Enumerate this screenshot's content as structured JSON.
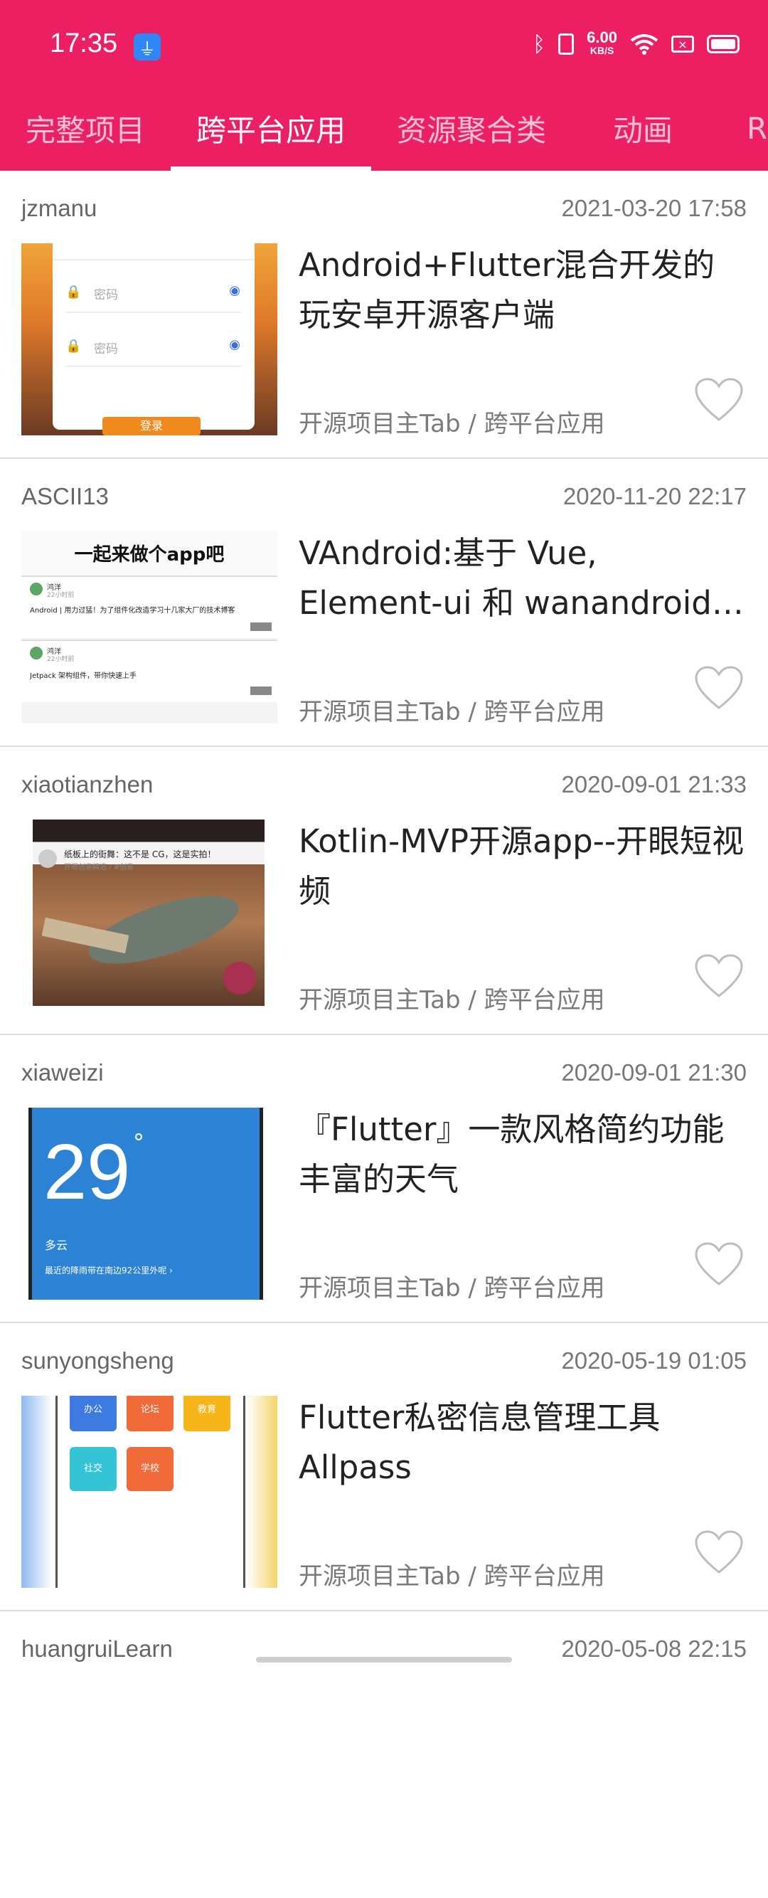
{
  "status_bar": {
    "time": "17:35",
    "net_speed_value": "6.00",
    "net_speed_unit": "KB/S",
    "icons": [
      "usb-debug-icon",
      "bluetooth-icon",
      "vibrate-icon",
      "wifi-icon",
      "sim-card-icon",
      "battery-icon"
    ]
  },
  "tabs": [
    {
      "label": "完整项目",
      "active": false
    },
    {
      "label": "跨平台应用",
      "active": true
    },
    {
      "label": "资源聚合类",
      "active": false
    },
    {
      "label": "动画",
      "active": false
    },
    {
      "label": "R",
      "active": false
    }
  ],
  "items": [
    {
      "author": "jzmanu",
      "date": "2021-03-20 17:58",
      "title": "Android+Flutter混合开发的玩安卓开源客户端",
      "chapter": "开源项目主Tab / 跨平台应用",
      "thumb_text": [
        "密码",
        "密码",
        "登录"
      ]
    },
    {
      "author": "ASCII13",
      "date": "2020-11-20 22:17",
      "title": "VAndroid:基于 Vue, Element-ui 和 wanandroid API 的开源客户端",
      "chapter": "开源项目主Tab / 跨平台应用",
      "thumb_text": [
        "一起来做个app吧",
        "鸿洋",
        "22小时前",
        "Android | 用力过猛！为了组件化改造学习十几家大厂的技术博客",
        "鸿洋",
        "22小时前",
        "Jetpack 架构组件，带你快速上手"
      ]
    },
    {
      "author": "xiaotianzhen",
      "date": "2020-09-01 21:33",
      "title": "Kotlin-MVP开源app--开眼短视频",
      "chapter": "开源项目主Tab / 跨平台应用",
      "thumb_text": [
        "纸板上的街舞：这不是 CG，这是实拍！",
        "开眼创意精选 / #创意"
      ]
    },
    {
      "author": "xiaweizi",
      "date": "2020-09-01 21:30",
      "title": "『Flutter』一款风格简约功能丰富的天气",
      "chapter": "开源项目主Tab / 跨平台应用",
      "thumb_text": [
        "29",
        "°",
        "多云",
        "最近的降雨带在南边92公里外呢 ›"
      ]
    },
    {
      "author": "sunyongsheng",
      "date": "2020-05-19 01:05",
      "title": "Flutter私密信息管理工具Allpass",
      "chapter": "开源项目主Tab / 跨平台应用",
      "thumb_text": [
        "办公",
        "论坛",
        "教育",
        "社交",
        "学校"
      ]
    },
    {
      "author": "huangruiLearn",
      "date": "2020-05-08 22:15",
      "title": "",
      "chapter": "",
      "thumb_text": []
    }
  ],
  "colors": {
    "primary": "#ec1f63",
    "divider": "#dcdcdc",
    "meta_text": "#7a7a7a"
  }
}
